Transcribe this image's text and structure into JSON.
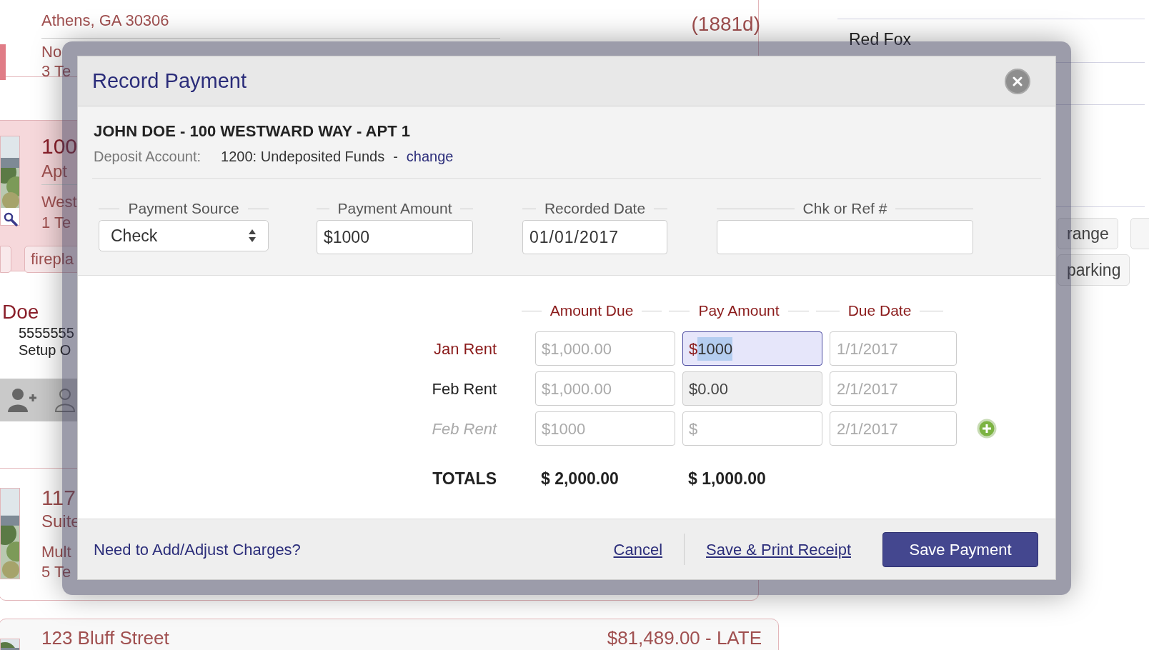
{
  "background": {
    "top_listing": {
      "address": "Athens, GA 30306",
      "age": "(1881d)",
      "group": "No",
      "tenants": "3 Te"
    },
    "listing_2": {
      "title": "100",
      "unit": "Apt",
      "street": "West",
      "tenants": "1 Te",
      "tags": [
        "firepla"
      ]
    },
    "contact": {
      "name": "Doe",
      "phone": "5555555",
      "note": "Setup O"
    },
    "listing_3": {
      "title": "117",
      "unit": "Suite",
      "type": "Mult",
      "tenants": "5 Te"
    },
    "bottom_listing": {
      "title": "123 Bluff Street",
      "balance": "$81,489.00 - LATE"
    },
    "side_panel": {
      "owner": "Red Fox",
      "tags": [
        "range",
        "parking"
      ]
    }
  },
  "dialog": {
    "title": "Record Payment",
    "tenant": "JOHN DOE - 100 WESTWARD WAY - APT 1",
    "deposit_label": "Deposit Account:",
    "deposit_account": "1200: Undeposited Funds",
    "separator": "-",
    "change_link": "change",
    "fields": [
      {
        "label": "Payment Source",
        "kind": "select",
        "value": "Check"
      },
      {
        "label": "Payment Amount",
        "kind": "currency",
        "prefix": "$",
        "value": "1000"
      },
      {
        "label": "Recorded Date",
        "kind": "text",
        "value": "01/01/2017"
      },
      {
        "label": "Chk or Ref #",
        "kind": "text"
      }
    ],
    "charges": {
      "columns": [
        "Amount Due",
        "Pay Amount",
        "Due Date"
      ],
      "rows": [
        {
          "label": "Jan Rent",
          "kind": "active",
          "amount_due": "$1,000.00",
          "pay_prefix": "$",
          "pay_value": "1000",
          "due_date": "1/1/2017"
        },
        {
          "label": "Feb Rent",
          "kind": "paid",
          "amount_due": "$1,000.00",
          "pay_prefix": "$",
          "pay_value": "0.00",
          "due_date": "2/1/2017"
        },
        {
          "label": "Feb Rent",
          "kind": "new",
          "amount_due": "$1000",
          "pay_prefix": "$",
          "due_date": "2/1/2017"
        }
      ],
      "totals": {
        "label": "TOTALS",
        "amount_due": "$ 2,000.00",
        "pay_amount": "$ 1,000.00"
      }
    },
    "footer": {
      "adjust_link": "Need to Add/Adjust Charges?",
      "cancel": "Cancel",
      "save_print": "Save & Print Receipt",
      "save": "Save Payment"
    }
  }
}
